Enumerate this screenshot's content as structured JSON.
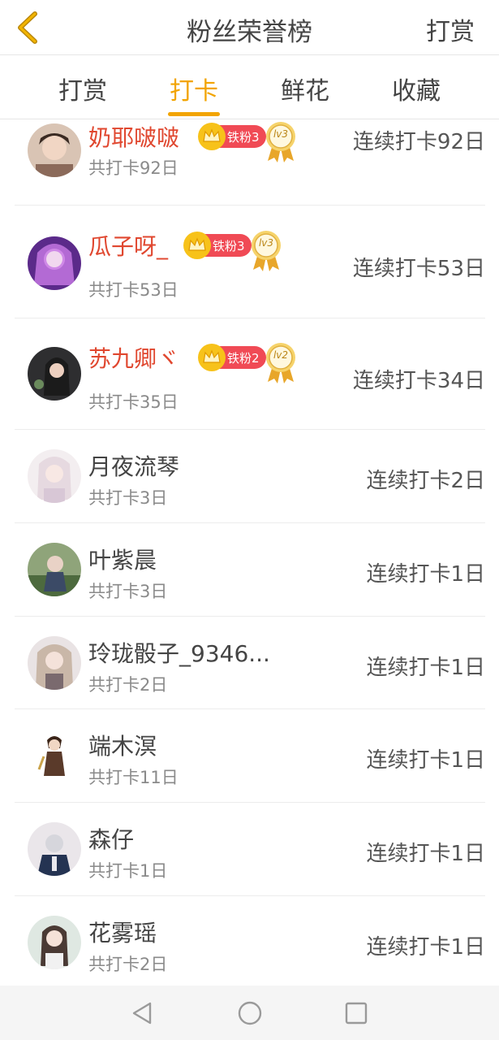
{
  "header": {
    "title": "粉丝荣誉榜",
    "right_label": "打赏"
  },
  "tabs": [
    {
      "label": "打赏",
      "active": false
    },
    {
      "label": "打卡",
      "active": true
    },
    {
      "label": "鲜花",
      "active": false
    },
    {
      "label": "收藏",
      "active": false
    }
  ],
  "colors": {
    "accent": "#f2a400",
    "top_name": "#e0472f",
    "badge": "#f04a55"
  },
  "rows": [
    {
      "name": "奶耶啵啵",
      "total": "共打卡92日",
      "streak": "连续打卡92日",
      "badge": "铁粉3",
      "level": "lv3"
    },
    {
      "name": "瓜子呀_",
      "total": "共打卡53日",
      "streak": "连续打卡53日",
      "badge": "铁粉3",
      "level": "lv3"
    },
    {
      "name": "苏九卿ヾ",
      "total": "共打卡35日",
      "streak": "连续打卡34日",
      "badge": "铁粉2",
      "level": "lv2"
    },
    {
      "name": "月夜流琴",
      "total": "共打卡3日",
      "streak": "连续打卡2日"
    },
    {
      "name": "叶紫晨",
      "total": "共打卡3日",
      "streak": "连续打卡1日"
    },
    {
      "name": "玲珑骰子_9346...",
      "total": "共打卡2日",
      "streak": "连续打卡1日"
    },
    {
      "name": "端木溟",
      "total": "共打卡11日",
      "streak": "连续打卡1日"
    },
    {
      "name": "森仔",
      "total": "共打卡1日",
      "streak": "连续打卡1日"
    },
    {
      "name": "花雾瑶",
      "total": "共打卡2日",
      "streak": "连续打卡1日"
    }
  ],
  "icons": {
    "back": "chevron-left-icon",
    "crown": "crown-icon",
    "medal": "medal-icon",
    "nav_back": "triangle-back-icon",
    "nav_home": "circle-home-icon",
    "nav_recent": "square-recent-icon"
  }
}
